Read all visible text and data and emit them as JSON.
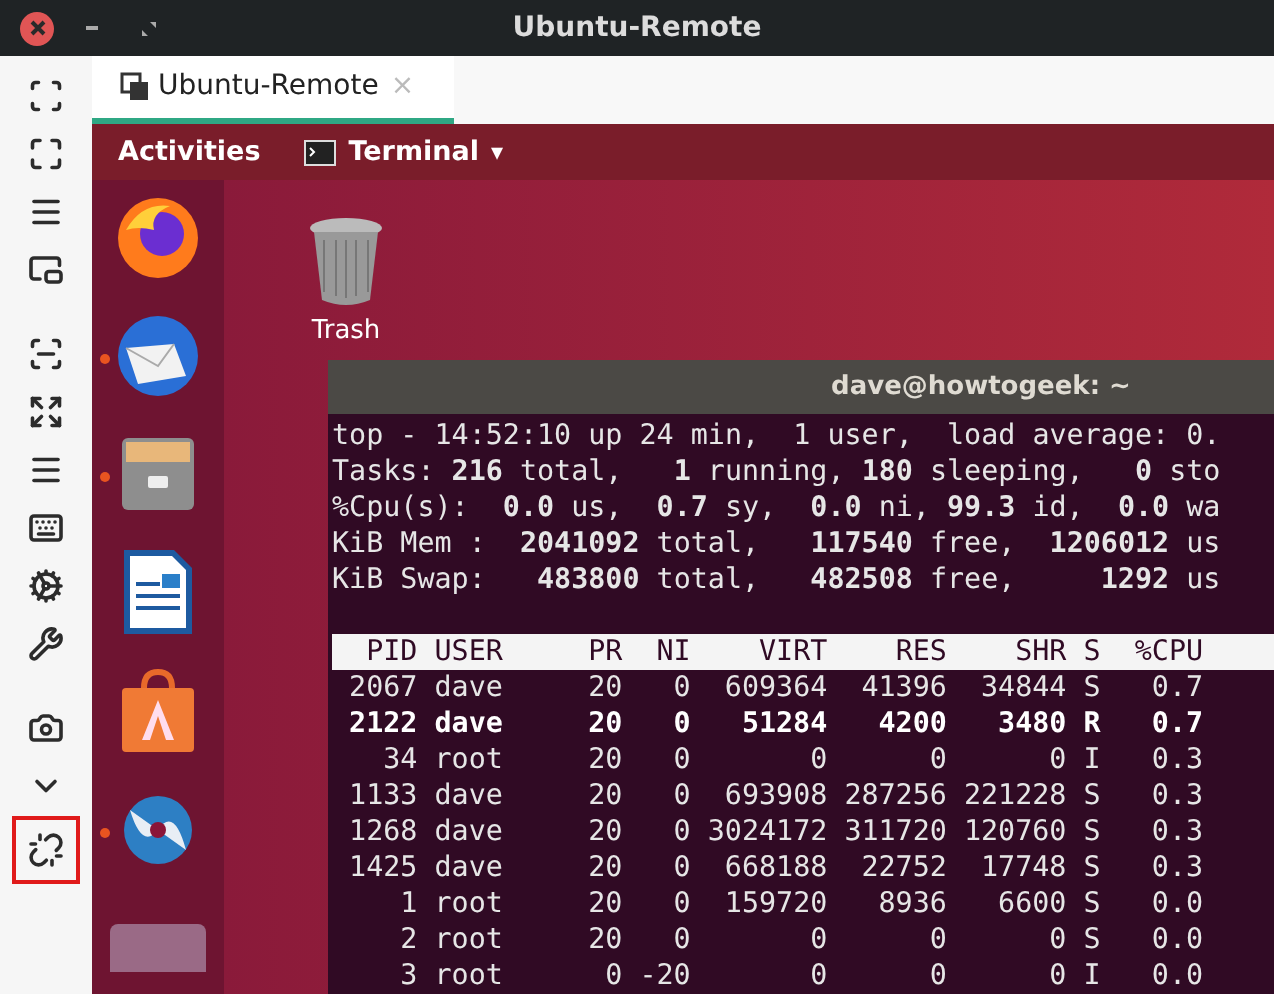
{
  "window": {
    "title": "Ubuntu-Remote"
  },
  "toolbar": [
    {
      "kind": "scale",
      "highlighted": false,
      "gap_before": false
    },
    {
      "kind": "fullscreen",
      "highlighted": false,
      "gap_before": false
    },
    {
      "kind": "menu",
      "highlighted": false,
      "gap_before": false
    },
    {
      "kind": "pip",
      "highlighted": false,
      "gap_before": false
    },
    {
      "kind": "scan",
      "highlighted": false,
      "gap_before": true
    },
    {
      "kind": "expand",
      "highlighted": false,
      "gap_before": false
    },
    {
      "kind": "menu",
      "highlighted": false,
      "gap_before": false
    },
    {
      "kind": "keyboard",
      "highlighted": false,
      "gap_before": false
    },
    {
      "kind": "cogs",
      "highlighted": false,
      "gap_before": false
    },
    {
      "kind": "wrench",
      "highlighted": false,
      "gap_before": false
    },
    {
      "kind": "camera",
      "highlighted": false,
      "gap_before": true
    },
    {
      "kind": "chevron",
      "highlighted": false,
      "gap_before": false
    },
    {
      "kind": "unlink",
      "highlighted": true,
      "gap_before": false
    }
  ],
  "tabs": [
    {
      "label": "Ubuntu-Remote",
      "close": "×",
      "selected": true
    }
  ],
  "topbar": {
    "activities": "Activities",
    "app": "Terminal",
    "caret": "▾"
  },
  "dock": [
    {
      "kind": "firefox",
      "running": false
    },
    {
      "kind": "mail",
      "running": true
    },
    {
      "kind": "files",
      "running": true
    },
    {
      "kind": "writer",
      "running": false
    },
    {
      "kind": "store",
      "running": false
    },
    {
      "kind": "swirl",
      "running": true
    },
    {
      "kind": "screen",
      "running": false
    }
  ],
  "desktop_icons": [
    {
      "label": "Trash"
    }
  ],
  "terminal": {
    "title": "dave@howtogeek: ~",
    "summary": [
      "top - 14:52:10 up 24 min,  1 user,  load average: 0.",
      "Tasks: **216** total,   **1** running, **180** sleeping,   **0** sto",
      "%Cpu(s):  **0.0** us,  **0.7** sy,  **0.0** ni, **99.3** id,  **0.0** wa",
      "KiB Mem :  **2041092** total,   **117540** free,  **1206012** us",
      "KiB Swap:   **483800** total,   **482508** free,     **1292** us"
    ],
    "table": {
      "columns": [
        "PID",
        "USER",
        "PR",
        "NI",
        "VIRT",
        "RES",
        "SHR",
        "S",
        "%CPU"
      ],
      "rows": [
        {
          "cells": [
            "2067",
            "dave",
            "20",
            "0",
            "609364",
            "41396",
            "34844",
            "S",
            "0.7"
          ],
          "running": false
        },
        {
          "cells": [
            "2122",
            "dave",
            "20",
            "0",
            "51284",
            "4200",
            "3480",
            "R",
            "0.7"
          ],
          "running": true
        },
        {
          "cells": [
            "34",
            "root",
            "20",
            "0",
            "0",
            "0",
            "0",
            "I",
            "0.3"
          ],
          "running": false
        },
        {
          "cells": [
            "1133",
            "dave",
            "20",
            "0",
            "693908",
            "287256",
            "221228",
            "S",
            "0.3"
          ],
          "running": false
        },
        {
          "cells": [
            "1268",
            "dave",
            "20",
            "0",
            "3024172",
            "311720",
            "120760",
            "S",
            "0.3"
          ],
          "running": false
        },
        {
          "cells": [
            "1425",
            "dave",
            "20",
            "0",
            "668188",
            "22752",
            "17748",
            "S",
            "0.3"
          ],
          "running": false
        },
        {
          "cells": [
            "1",
            "root",
            "20",
            "0",
            "159720",
            "8936",
            "6600",
            "S",
            "0.0"
          ],
          "running": false
        },
        {
          "cells": [
            "2",
            "root",
            "20",
            "0",
            "0",
            "0",
            "0",
            "S",
            "0.0"
          ],
          "running": false
        },
        {
          "cells": [
            "3",
            "root",
            "0",
            "-20",
            "0",
            "0",
            "0",
            "I",
            "0.0"
          ],
          "running": false
        }
      ]
    }
  }
}
